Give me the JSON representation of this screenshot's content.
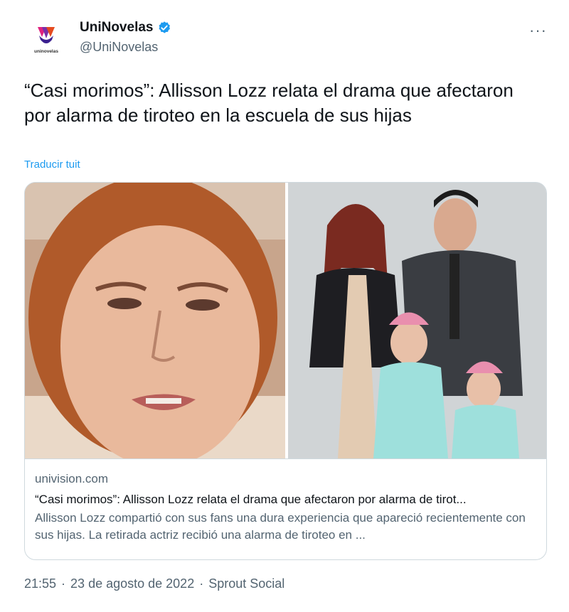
{
  "account": {
    "display_name": "UniNovelas",
    "handle": "@UniNovelas",
    "logo_text": "uninovelas"
  },
  "tweet": {
    "text": "“Casi morimos”: Allisson Lozz relata el drama que afectaron por alarma de tiroteo en la escuela de sus hijas",
    "translate_label": "Traducir tuit",
    "more_label": "···"
  },
  "card": {
    "domain": "univision.com",
    "title": "“Casi morimos”: Allisson Lozz relata el drama que afectaron por alarma de tirot...",
    "description": "Allisson Lozz compartió con sus fans una dura experiencia que apareció recientemente con sus hijas. La retirada actriz recibió una alarma de tiroteo en ..."
  },
  "meta": {
    "time": "21:55",
    "date": "23 de agosto de 2022",
    "separator": "·",
    "source": "Sprout Social"
  },
  "icons": {
    "verified": "verified-badge-icon",
    "more": "more-options-icon"
  },
  "colors": {
    "link_blue": "#1d9bf0",
    "secondary_text": "#536471",
    "border": "#cfd9de"
  }
}
